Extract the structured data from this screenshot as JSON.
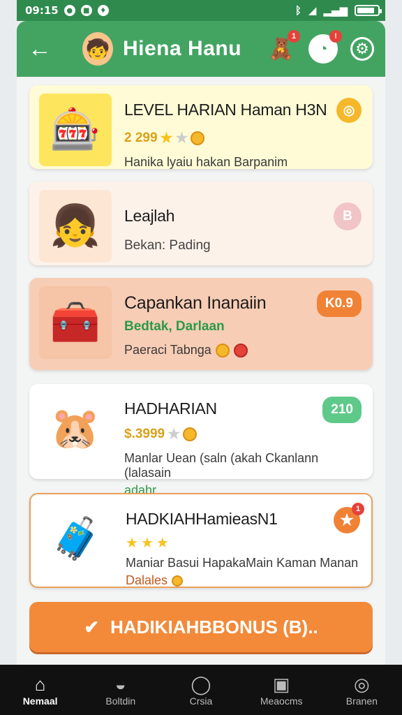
{
  "status": {
    "time": "09:15",
    "battery_level": 0.85
  },
  "header": {
    "title": "Hiena Hanu"
  },
  "cards": [
    {
      "title": "LEVEL HARIAN Haman H3N",
      "line": "2 299",
      "desc": "Hanika lyaiu hakan Barpanim",
      "pill": ""
    },
    {
      "title": "Leajlah",
      "line": "Bekan: Pading",
      "desc": "",
      "pill": "B"
    },
    {
      "title": "Capankan Inanaiin",
      "line": "Bedtak, Darlaan",
      "desc": "Paeraci Tabnga",
      "pill": "K0.9"
    },
    {
      "title": "HADHARIAN",
      "line": "$.3999",
      "desc": "Manlar Uean (saln (akah Ckanlann (lalasain",
      "desc2": "adahr.",
      "pill": "210"
    },
    {
      "title": "HADKIAHHamieasN1",
      "line": "",
      "desc": "Maniar Basui HapakaMain Kaman Manan",
      "desc2": "Dalales",
      "pill": "1"
    }
  ],
  "bonus": {
    "label": "HADIKIAHBBONUS (B).."
  },
  "nav": [
    {
      "label": "Nemaal"
    },
    {
      "label": "Boltdin"
    },
    {
      "label": "Crsia"
    },
    {
      "label": "Meaocms"
    },
    {
      "label": "Branen"
    }
  ],
  "colors": {
    "header": "#43a462",
    "status": "#2f8a4e",
    "bonus": "#f28a3a"
  }
}
